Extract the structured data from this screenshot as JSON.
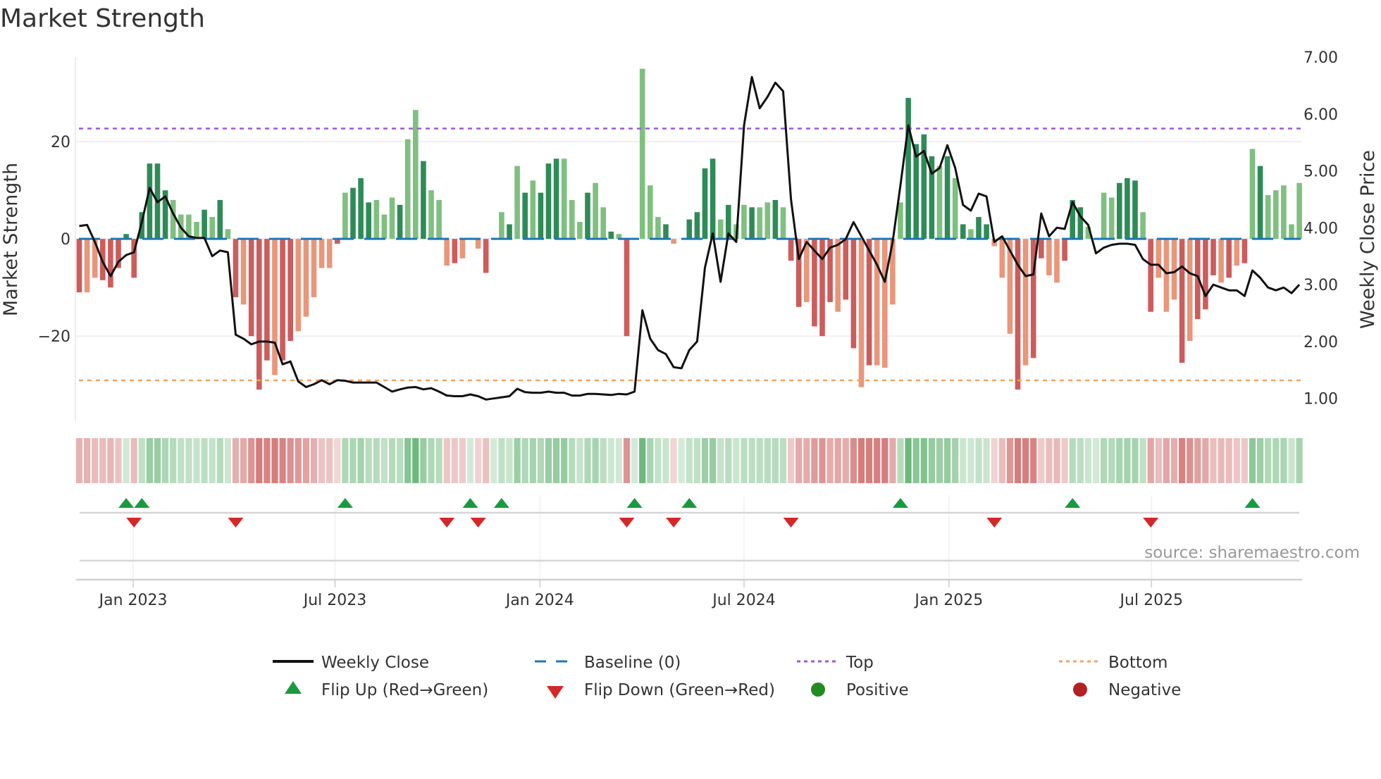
{
  "title": "Market Strength",
  "source": "source: sharemaestro.com",
  "colors": {
    "strong_pos": "#2e8b57",
    "weak_pos": "#7fbf7f",
    "strong_neg": "#cd5c5c",
    "weak_neg": "#e9967a",
    "baseline": "#1f77b4",
    "top": "#9b59d6",
    "bottom": "#f4a460",
    "flip_up": "#1a9a3f",
    "flip_down": "#d62728",
    "positive": "#228b22",
    "negative": "#b22222",
    "price": "#111111"
  },
  "legend": {
    "weekly_close": "Weekly Close",
    "baseline": "Baseline (0)",
    "top": "Top",
    "bottom": "Bottom",
    "flip_up": "Flip Up (Red→Green)",
    "flip_down": "Flip Down (Green→Red)",
    "positive": "Positive",
    "negative": "Negative"
  },
  "chart_data": {
    "type": "bar",
    "title": "Market Strength",
    "ylabel": "Market Strength",
    "y2label": "Weekly Close Price",
    "ylim": [
      -37.5,
      37.4
    ],
    "y2lim": [
      0.6,
      7.0
    ],
    "yticks": [
      {
        "v": 20,
        "label": "20"
      },
      {
        "v": 0,
        "label": "0"
      },
      {
        "v": -20,
        "label": "−20"
      }
    ],
    "y2ticks": [
      {
        "v": 7,
        "label": "7.00"
      },
      {
        "v": 6,
        "label": "6.00"
      },
      {
        "v": 5,
        "label": "5.00"
      },
      {
        "v": 4,
        "label": "4.00"
      },
      {
        "v": 3,
        "label": "3.00"
      },
      {
        "v": 2,
        "label": "2.00"
      },
      {
        "v": 1,
        "label": "1.00"
      }
    ],
    "xticks": [
      {
        "week": 6.9,
        "label": "Jan 2023"
      },
      {
        "week": 32.7,
        "label": "Jul 2023"
      },
      {
        "week": 58.9,
        "label": "Jan 2024"
      },
      {
        "week": 85.0,
        "label": "Jul 2024"
      },
      {
        "week": 111.2,
        "label": "Jan 2025"
      },
      {
        "week": 137.1,
        "label": "Jul 2025"
      }
    ],
    "top_level": 22.7,
    "bottom_level": -29.1,
    "strength": [
      -11,
      -11,
      -8,
      -8.5,
      -10,
      -6,
      1,
      -8,
      5.5,
      15.5,
      15.5,
      10,
      8,
      5,
      5,
      3.5,
      6,
      4.5,
      8,
      2,
      -12,
      -13.5,
      -20,
      -31,
      -25,
      -28,
      -25,
      -21,
      -19,
      -16,
      -12,
      -6,
      -6,
      -1,
      9.5,
      10.5,
      12.5,
      7.5,
      8,
      5,
      8.5,
      7,
      20.5,
      26.5,
      16,
      10,
      8,
      -5.5,
      -5,
      -4,
      0.2,
      -2,
      -7,
      0,
      5.5,
      3,
      15,
      9.5,
      12,
      9.5,
      15.5,
      16.5,
      16.5,
      8,
      3.5,
      9.5,
      11.5,
      6.5,
      1.5,
      1,
      -20,
      0,
      35,
      11,
      4.5,
      3,
      -1,
      0,
      4,
      5.5,
      14.5,
      16.5,
      4,
      7,
      3,
      7,
      6.5,
      6.5,
      7.5,
      8,
      6.5,
      -4.5,
      -14,
      -13,
      -18,
      -20,
      -13,
      -15,
      -12.5,
      -22.5,
      -30.5,
      -26,
      -26,
      -26.5,
      -13.5,
      7.5,
      29,
      19.5,
      21.5,
      17,
      15,
      17,
      12.5,
      3,
      2,
      4.5,
      3,
      -1.5,
      -8,
      -19.5,
      -31,
      -26,
      -24.5,
      -4,
      -7.5,
      -9,
      -4.5,
      8,
      6.5,
      2.5,
      0.2,
      9.5,
      8.5,
      11.5,
      12.5,
      12,
      5.5,
      -15,
      -8,
      -15,
      -12.5,
      -25.5,
      -21,
      -16.5,
      -14.5,
      -7.5,
      -9,
      -8,
      -5.5,
      -5,
      18.5,
      15,
      9,
      10,
      11,
      3,
      11.5
    ],
    "shade": "dlldddddddddlllldldldldddlddllllldldddllldlldllldllnddldldldddllldlldnddllldndddddldlldlldlddldddlddldllllddddldldlddllldlddlldddlllldddldllndldddldldldllllldldldddldl",
    "weekly_close": [
      4.03,
      4.05,
      3.75,
      3.4,
      3.15,
      3.4,
      3.52,
      3.57,
      4.1,
      4.7,
      4.45,
      4.55,
      4.25,
      4.0,
      3.85,
      3.82,
      3.82,
      3.5,
      3.6,
      3.57,
      2.12,
      2.05,
      1.95,
      2.0,
      2.0,
      1.98,
      1.6,
      1.65,
      1.3,
      1.2,
      1.25,
      1.32,
      1.25,
      1.32,
      1.31,
      1.28,
      1.28,
      1.28,
      1.28,
      1.2,
      1.12,
      1.16,
      1.19,
      1.2,
      1.16,
      1.18,
      1.12,
      1.05,
      1.04,
      1.04,
      1.07,
      1.04,
      0.98,
      1.0,
      1.02,
      1.04,
      1.17,
      1.11,
      1.1,
      1.1,
      1.12,
      1.1,
      1.1,
      1.05,
      1.05,
      1.08,
      1.08,
      1.07,
      1.06,
      1.08,
      1.07,
      1.12,
      2.55,
      2.05,
      1.85,
      1.78,
      1.55,
      1.53,
      1.85,
      2.0,
      3.3,
      3.9,
      3.05,
      3.9,
      3.75,
      5.8,
      6.65,
      6.1,
      6.3,
      6.55,
      6.4,
      4.5,
      3.45,
      3.75,
      3.6,
      3.45,
      3.65,
      3.7,
      3.8,
      4.1,
      3.85,
      3.6,
      3.35,
      3.05,
      3.75,
      4.75,
      5.8,
      5.25,
      5.35,
      4.95,
      5.05,
      5.45,
      5.05,
      4.4,
      4.3,
      4.6,
      4.55,
      3.75,
      3.85,
      3.6,
      3.35,
      3.15,
      3.18,
      4.25,
      3.85,
      4.0,
      3.98,
      4.45,
      4.2,
      4.05,
      3.55,
      3.65,
      3.7,
      3.72,
      3.72,
      3.7,
      3.45,
      3.35,
      3.35,
      3.2,
      3.22,
      3.32,
      3.2,
      3.15,
      2.8,
      3.0,
      2.95,
      2.9,
      2.9,
      2.8,
      3.25,
      3.12,
      2.95,
      2.9,
      2.95,
      2.85,
      3.0
    ],
    "flip_up_weeks": [
      6,
      8,
      34,
      50,
      54,
      71,
      78,
      105,
      127,
      150
    ],
    "flip_down_weeks": [
      7,
      20,
      47,
      51,
      70,
      76,
      91,
      117,
      137
    ]
  }
}
